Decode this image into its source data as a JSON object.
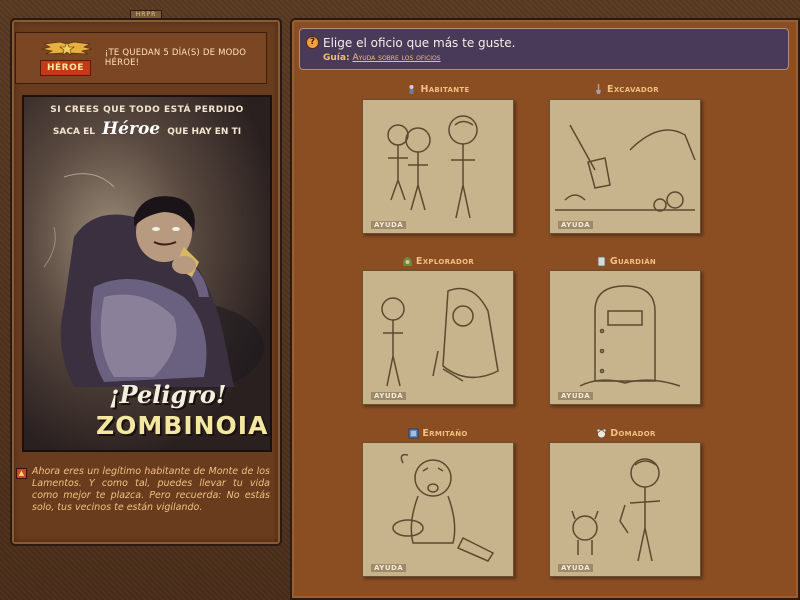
{
  "header": {
    "plaque": "HRPR"
  },
  "hero": {
    "badge": "HÉROE",
    "message": "¡TE QUEDAN 5 DÍA(S) DE MODO HÉROE!"
  },
  "poster": {
    "line1": "SI CREES QUE TODO ESTÁ PERDIDO",
    "line2_pre": "SACA EL",
    "line2_big": "Héroe",
    "line2_post": "QUE HAY EN TI",
    "title1": "¡Peligro!",
    "title2": "ZOMBINOIA"
  },
  "info": {
    "text": "Ahora eres un legítimo habitante de Monte de los Lamentos. Y como tal, puedes llevar tu vida como mejor te plazca. Pero recuerda: No estás solo, tus vecinos te están vigilando."
  },
  "dialog": {
    "title": "Elige el oficio que más te guste.",
    "guide_label": "Guía:",
    "guide_link": "Ayuda sobre los oficios"
  },
  "jobs": [
    {
      "name": "Habitante",
      "help": "AYUDA",
      "icon": "person-icon"
    },
    {
      "name": "Excavador",
      "help": "AYUDA",
      "icon": "shovel-icon"
    },
    {
      "name": "Explorador",
      "help": "AYUDA",
      "icon": "hood-icon"
    },
    {
      "name": "Guardián",
      "help": "AYUDA",
      "icon": "shield-icon"
    },
    {
      "name": "Ermitaño",
      "help": "AYUDA",
      "icon": "book-icon"
    },
    {
      "name": "Domador",
      "help": "AYUDA",
      "icon": "dog-icon"
    }
  ]
}
